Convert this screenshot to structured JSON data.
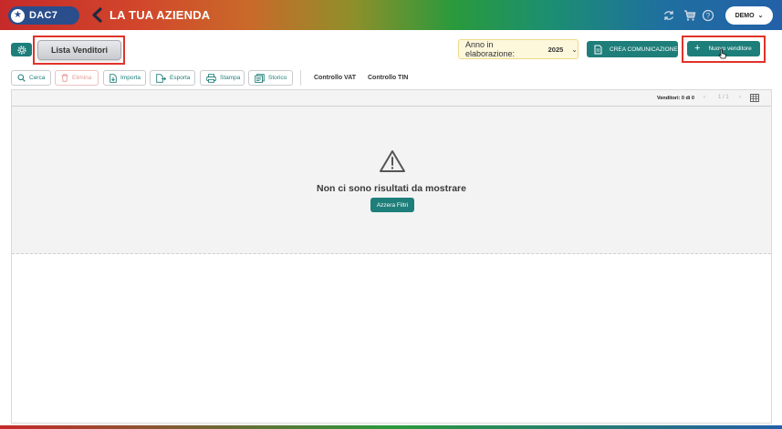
{
  "header": {
    "logo_text": "DAC7",
    "title": "LA TUA AZIENDA",
    "user_button": "DEMO",
    "icons": [
      "refresh-icon",
      "cart-icon",
      "help-icon"
    ]
  },
  "top": {
    "tab_label": "Lista Venditori",
    "year_label": "Anno in elaborazione:",
    "year_value": "2025",
    "create_button": "CREA COMUNICAZIONE",
    "new_button": "Nuovo venditore"
  },
  "toolbar": {
    "search": "Cerca",
    "delete": "Elimina",
    "import": "Importa",
    "export": "Esporta",
    "print": "Stampa",
    "history": "Storico",
    "vat_check": "Controllo VAT",
    "tin_check": "Controllo TIN"
  },
  "table": {
    "count_label": "Venditori: 0 di 0",
    "page_label": "1 / 1",
    "empty_message": "Non ci sono risultati da mostrare",
    "reset_button": "Azzera Filtri"
  },
  "colors": {
    "primary": "#1e7e7a",
    "highlight": "#e0322a",
    "year_bg": "#fdf7dc"
  }
}
